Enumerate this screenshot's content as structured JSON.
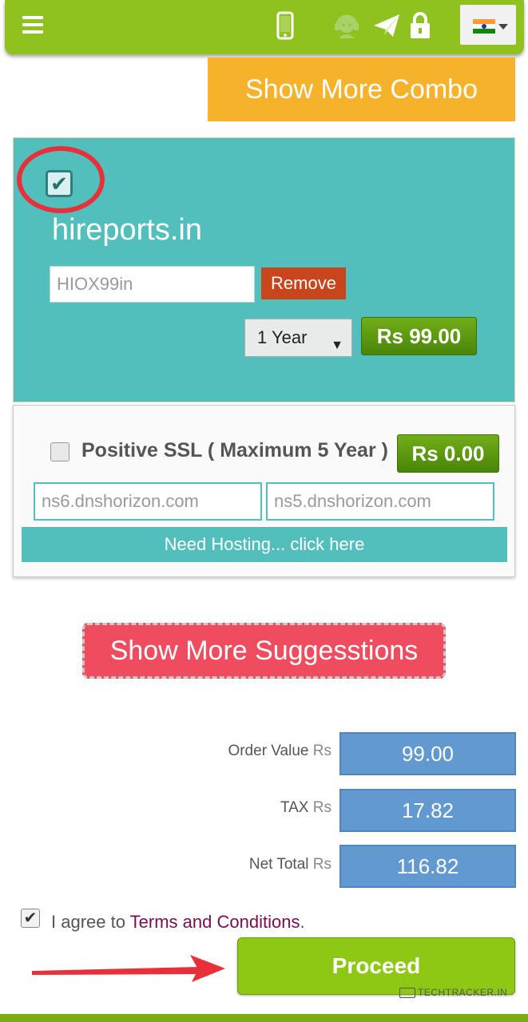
{
  "header": {
    "icons": [
      "menu-icon",
      "phone-icon",
      "support-icon",
      "send-icon",
      "lock-icon",
      "india-flag-icon"
    ]
  },
  "combo_button": {
    "label": "Show More Combo"
  },
  "domain": {
    "name": "hireports.in",
    "checked": true,
    "promo_code": "HIOX99in",
    "remove_label": "Remove",
    "period": "1 Year",
    "price": "Rs 99.00"
  },
  "ssl": {
    "label": "Positive SSL ( Maximum 5 Year )",
    "price": "Rs 0.00",
    "checked": false,
    "ns1": "ns6.dnshorizon.com",
    "ns2": "ns5.dnshorizon.com",
    "hosting_label": "Need Hosting... click here"
  },
  "suggest_button": {
    "label": "Show More Suggesstions"
  },
  "summary": {
    "currency": "Rs",
    "order_value_label": "Order Value",
    "order_value": "99.00",
    "tax_label": "TAX",
    "tax": "17.82",
    "net_total_label": "Net Total",
    "net_total": "116.82"
  },
  "agree": {
    "prefix": "I agree to",
    "link": "Terms and Conditions",
    "suffix": ".",
    "checked": true
  },
  "proceed": {
    "label": "Proceed"
  },
  "watermark": {
    "text": "TECHTRACKER.IN"
  },
  "colors": {
    "topbar": "#8fc21e",
    "combo": "#f7b22b",
    "teal": "#53bfbc",
    "price_green": "#4a8509",
    "remove": "#c9451b",
    "suggest": "#ef4d5f",
    "summary_box": "#6299d0",
    "proceed": "#8ec814",
    "terms_link": "#7a0c4f",
    "annotation_red": "#e8303a"
  }
}
